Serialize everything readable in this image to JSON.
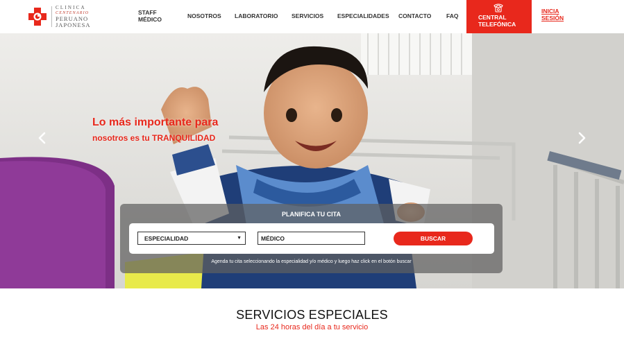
{
  "brand": {
    "logo_line1": "CLINICA",
    "logo_line2": "CENTENARIO",
    "logo_line3": "PERUANO",
    "logo_line4": "JAPONESA",
    "accent_color": "#e8281c"
  },
  "nav": {
    "staff": "STAFF MÉDICO",
    "nosotros": "NOSOTROS",
    "laboratorio": "LABORATORIO",
    "servicios": "SERVICIOS",
    "especialidades": "ESPECIALIDADES",
    "contacto": "CONTACTO",
    "faq": "FAQ",
    "central": "CENTRAL TELEFÓNICA",
    "central_icon": "phone-icon",
    "login": "INICIA SESIÓN"
  },
  "hero": {
    "slogan_line1": "Lo más importante para",
    "slogan_line2_prefix": "nosotros es tu ",
    "slogan_line2_strong": "TRANQUILIDAD",
    "prev_icon": "chevron-left-icon",
    "next_icon": "chevron-right-icon"
  },
  "planner": {
    "title": "PLANIFICA TU CITA",
    "specialty_selected": "ESPECIALIDAD",
    "doctor_value": "MÉDICO",
    "search_label": "BUSCAR",
    "hint": "Agenda tu cita seleccionando la especialidad y/o médico y luego haz click en el botón buscar"
  },
  "services": {
    "title": "SERVICIOS ESPECIALES",
    "subtitle": "Las 24 horas del día a tu servicio"
  }
}
